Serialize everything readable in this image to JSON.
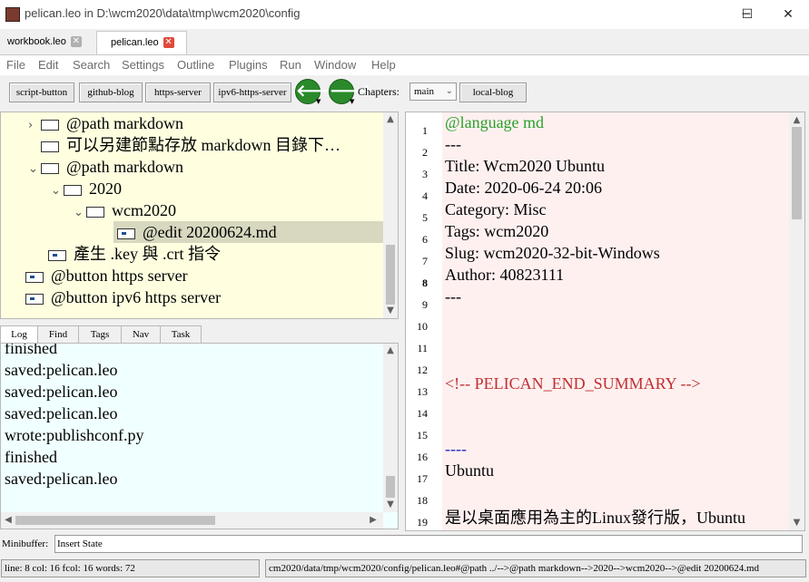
{
  "window": {
    "title": "pelican.leo in D:\\wcm2020\\data\\tmp\\wcm2020\\config",
    "icon": "leo-app-icon",
    "controls": {
      "minimize": "─",
      "maximize": "☐",
      "close": "✕"
    }
  },
  "tabs": [
    {
      "label": "workbook.leo",
      "close": "✕",
      "active": false
    },
    {
      "label": "pelican.leo",
      "close": "✕",
      "active": true
    }
  ],
  "menu": [
    "File",
    "Edit",
    "Search",
    "Settings",
    "Outline",
    "Plugins",
    "Run",
    "Window",
    "Help"
  ],
  "toolbar": {
    "buttons": [
      "script-button",
      "github-blog",
      "https-server",
      "ipv6-https-server"
    ],
    "back_icon": "🡐",
    "forward_icon": "🡒",
    "chapters_label": "Chapters:",
    "chapter_selected": "main",
    "chapter_button": "local-blog"
  },
  "outline": {
    "nodes": [
      {
        "chev": "›",
        "text": "@path markdown",
        "type": "plain"
      },
      {
        "chev": "",
        "text": "可以另建節點存放 markdown 目錄下…",
        "type": "plain"
      },
      {
        "chev": "⌄",
        "text": "@path markdown",
        "type": "plain"
      },
      {
        "chev": "⌄",
        "text": "2020",
        "type": "plain"
      },
      {
        "chev": "⌄",
        "text": "wcm2020",
        "type": "plain"
      },
      {
        "chev": "",
        "text": "@edit 20200624.md",
        "type": "clone"
      },
      {
        "chev": "",
        "text": "產生 .key 與 .crt 指令",
        "type": "clone"
      },
      {
        "chev": "",
        "text": "@button https server",
        "type": "clone"
      },
      {
        "chev": "",
        "text": "@button ipv6 https server",
        "type": "clone"
      }
    ]
  },
  "log_tabs": [
    "Log",
    "Find",
    "Tags",
    "Nav",
    "Task"
  ],
  "log": [
    "finished",
    "saved:pelican.leo",
    "saved:pelican.leo",
    "saved:pelican.leo",
    "wrote:publishconf.py",
    "finished",
    "saved:pelican.leo"
  ],
  "body": {
    "line_numbers": [
      "1",
      "2",
      "3",
      "4",
      "5",
      "6",
      "7",
      "8",
      "9",
      "10",
      "11",
      "12",
      "13",
      "14",
      "15",
      "16",
      "17",
      "18",
      "19"
    ],
    "lines": [
      "@language md",
      "---",
      "Title:  Wcm2020 Ubuntu",
      "Date: 2020-06-24  20:06",
      "Category: Misc",
      "Tags: wcm2020",
      "Slug: wcm2020-32-bit-Windows",
      "Author: 40823111",
      "---",
      "",
      "",
      "",
      "<!-- PELICAN_END_SUMMARY -->",
      "",
      "",
      "----",
      " Ubuntu",
      "",
      " 是以桌面應用為主的Linux發行版，Ubuntu"
    ],
    "colors": {
      "directive": "#2aa02a",
      "comment": "#c03030",
      "rule": "#2020c0"
    }
  },
  "minibuffer": {
    "label": "Minibuffer:",
    "value": "Insert State"
  },
  "status": {
    "position": "line: 8 col: 16  fcol: 16 words: 72",
    "path": "cm2020/data/tmp/wcm2020/config/pelican.leo#@path ../-->@path markdown-->2020-->wcm2020-->@edit 20200624.md"
  }
}
